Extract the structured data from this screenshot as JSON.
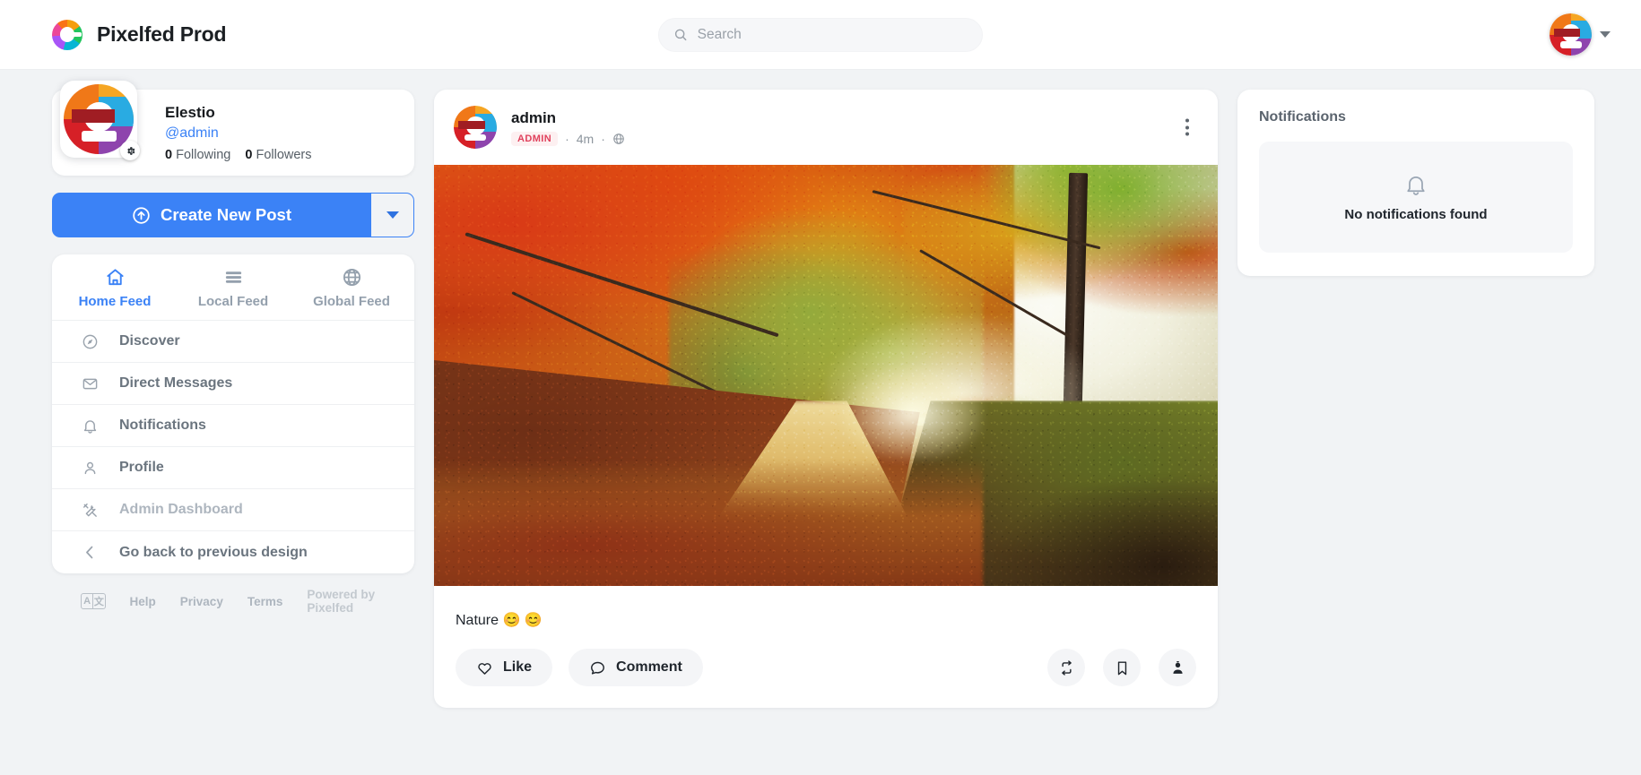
{
  "topbar": {
    "brand_title": "Pixelfed Prod",
    "brand_logo_icon": "pixelfed-logo-icon",
    "search": {
      "placeholder": "Search",
      "value": "",
      "icon": "search-icon"
    },
    "account_menu": {
      "avatar_icon": "elestio-avatar",
      "caret_icon": "chevron-down-icon"
    }
  },
  "profile": {
    "display_name": "Elestio",
    "handle": "@admin",
    "following_count": "0",
    "following_label": "Following",
    "followers_count": "0",
    "followers_label": "Followers",
    "settings_icon": "gear-icon",
    "avatar_icon": "elestio-avatar"
  },
  "create_post": {
    "label": "Create New Post",
    "icon": "arrow-up-circle-icon",
    "caret_icon": "chevron-down-icon",
    "accent_color": "#3b82f6"
  },
  "feed_tabs": [
    {
      "label": "Home Feed",
      "icon": "home-icon",
      "active": true
    },
    {
      "label": "Local Feed",
      "icon": "list-icon",
      "active": false
    },
    {
      "label": "Global Feed",
      "icon": "globe-icon",
      "active": false
    }
  ],
  "nav_items": [
    {
      "label": "Discover",
      "icon": "compass-icon",
      "muted": false
    },
    {
      "label": "Direct Messages",
      "icon": "envelope-icon",
      "muted": false
    },
    {
      "label": "Notifications",
      "icon": "bell-icon",
      "muted": false
    },
    {
      "label": "Profile",
      "icon": "person-icon",
      "muted": false
    },
    {
      "label": "Admin Dashboard",
      "icon": "tools-icon",
      "muted": true
    },
    {
      "label": "Go back to previous design",
      "icon": "chevron-left-icon",
      "muted": false
    }
  ],
  "footer": {
    "translate_icon": "translate-icon",
    "translate_left": "A",
    "translate_right": "文",
    "help": "Help",
    "privacy": "Privacy",
    "terms": "Terms",
    "powered_by": "Powered by Pixelfed"
  },
  "post": {
    "username": "admin",
    "badge": "ADMIN",
    "sep1": "·",
    "timestamp": "4m",
    "sep2": "·",
    "visibility_icon": "globe-icon",
    "menu_icon": "kebab-menu-icon",
    "avatar_icon": "elestio-avatar",
    "image_alt": "autumn forest path with red and orange foliage",
    "caption": "Nature 😊 😊",
    "like_label": "Like",
    "like_icon": "heart-icon",
    "comment_label": "Comment",
    "comment_icon": "speech-bubble-icon",
    "repost_icon": "repost-icon",
    "bookmark_icon": "bookmark-icon",
    "share_icon": "share-person-icon",
    "badge_color": "#e0415c"
  },
  "notifications": {
    "title": "Notifications",
    "empty_text": "No notifications found",
    "empty_icon": "bell-icon"
  }
}
